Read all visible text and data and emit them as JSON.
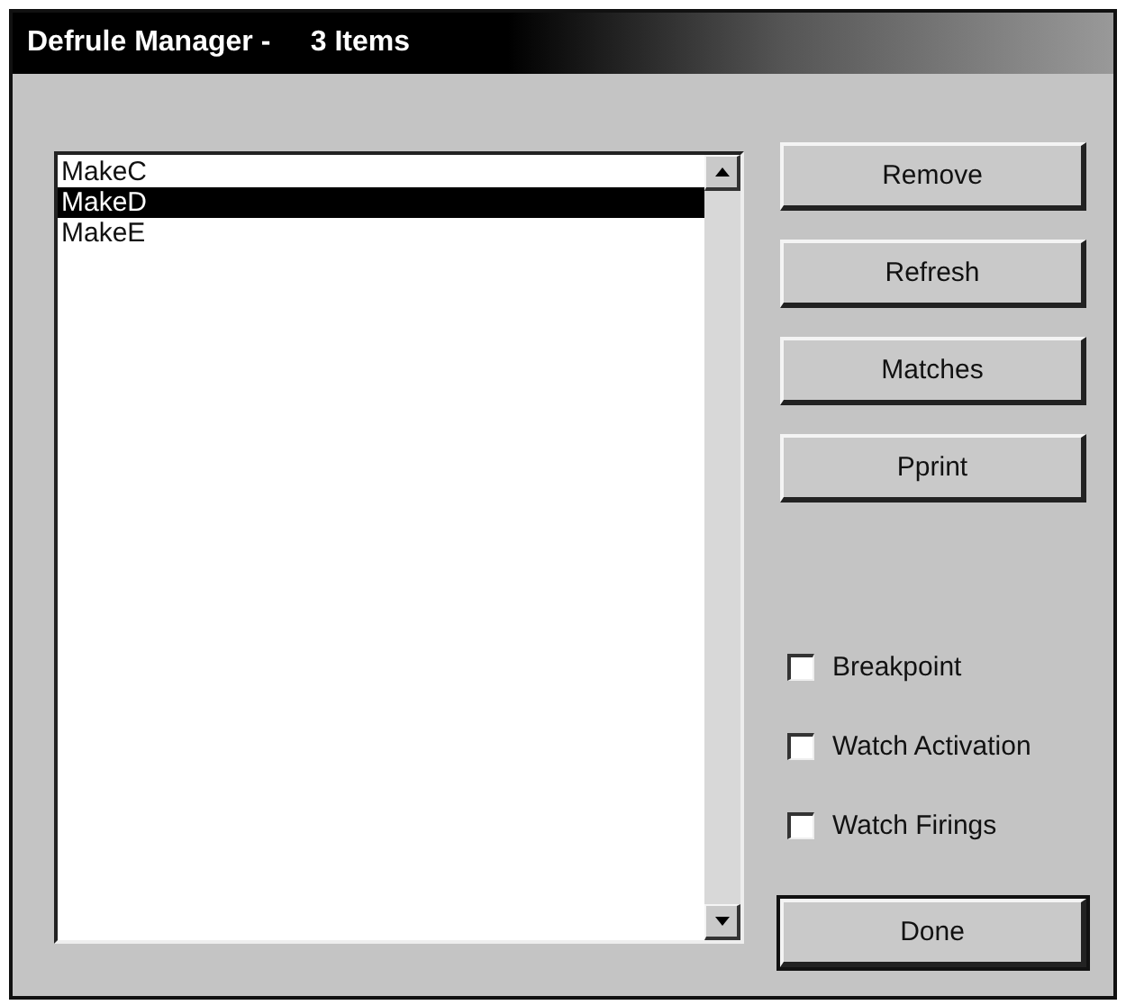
{
  "window": {
    "title": "Defrule Manager -     3 Items"
  },
  "rules_list": {
    "items": [
      {
        "label": "MakeC",
        "selected": false
      },
      {
        "label": "MakeD",
        "selected": true
      },
      {
        "label": "MakeE",
        "selected": false
      }
    ]
  },
  "buttons": [
    {
      "label": "Remove",
      "disabled": false
    },
    {
      "label": "Refresh",
      "disabled": false
    },
    {
      "label": "Matches",
      "disabled": false
    },
    {
      "label": "Pprint",
      "disabled": false
    }
  ],
  "options": [
    {
      "label": "Breakpoint",
      "checked": false
    },
    {
      "label": "Watch Activation",
      "checked": false
    },
    {
      "label": "Watch Firings",
      "checked": false
    }
  ],
  "done_button": {
    "label": "Done"
  }
}
